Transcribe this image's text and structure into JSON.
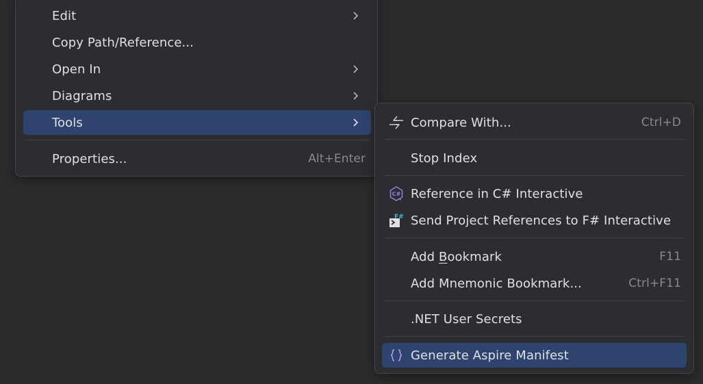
{
  "main_menu": {
    "items": [
      {
        "label": "Edit",
        "has_submenu": true
      },
      {
        "label": "Copy Path/Reference...",
        "has_submenu": false
      },
      {
        "label": "Open In",
        "has_submenu": true
      },
      {
        "label": "Diagrams",
        "has_submenu": true
      },
      {
        "label": "Tools",
        "has_submenu": true,
        "selected": true
      },
      {
        "label": "Properties...",
        "shortcut": "Alt+Enter"
      }
    ]
  },
  "tools_submenu": {
    "items": [
      {
        "label": "Compare With...",
        "shortcut": "Ctrl+D",
        "icon": "compare-arrows-icon"
      },
      {
        "label": "Stop Index"
      },
      {
        "label": "Reference in C# Interactive",
        "icon": "csharp-interactive-icon",
        "icon_text": "C#"
      },
      {
        "label": "Send Project References to F# Interactive",
        "icon": "fsharp-interactive-icon",
        "icon_text": "F#"
      },
      {
        "label_pre": "Add ",
        "label_mnemonic": "B",
        "label_post": "ookmark",
        "shortcut": "F11"
      },
      {
        "label": "Add Mnemonic Bookmark...",
        "shortcut": "Ctrl+F11"
      },
      {
        "label": ".NET User Secrets"
      },
      {
        "label": "Generate Aspire Manifest",
        "icon": "braces-icon",
        "selected": true
      }
    ]
  },
  "colors": {
    "background": "#2b2b2c",
    "menu_bg": "#2b2d30",
    "selection": "#2e436e",
    "text": "#dfe1e5",
    "shortcut": "#868a91",
    "csharp_accent": "#9b7bdc",
    "fsharp_accent": "#3fb6e6"
  }
}
